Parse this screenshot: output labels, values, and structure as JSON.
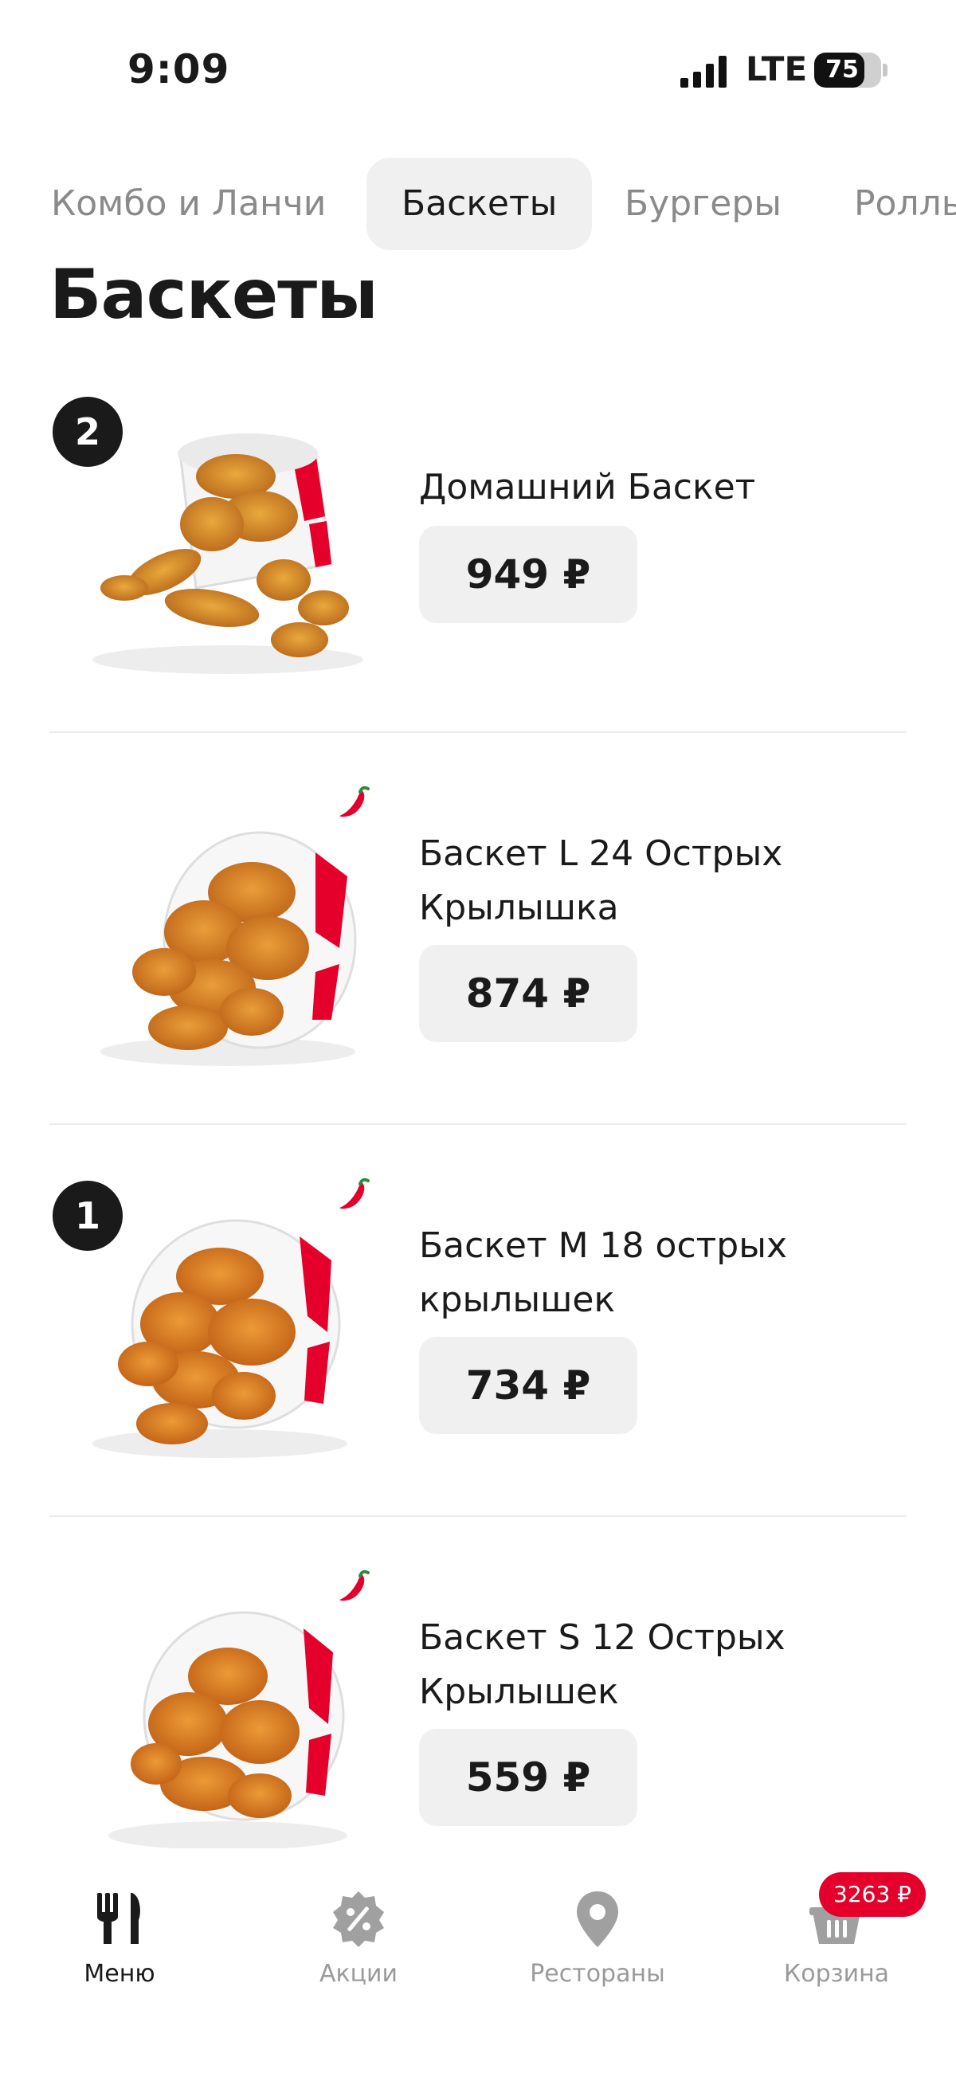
{
  "status_bar": {
    "time": "9:09",
    "network": "LTE",
    "battery": "75",
    "battery_level": 0.75
  },
  "tabs": [
    {
      "label": "Комбо и Ланчи",
      "active": false
    },
    {
      "label": "Баскеты",
      "active": true
    },
    {
      "label": "Бургеры",
      "active": false
    },
    {
      "label": "Роллы",
      "active": false
    }
  ],
  "page_title": "Баскеты",
  "products": [
    {
      "name": "Домашний Баскет",
      "price": "949 ₽",
      "qty_badge": "2",
      "spicy": false
    },
    {
      "name": "Баскет L 24 Острых Крылышка",
      "price": "874 ₽",
      "qty_badge": "",
      "spicy": true
    },
    {
      "name": "Баскет M 18 острых крылышек",
      "price": "734 ₽",
      "qty_badge": "1",
      "spicy": true
    },
    {
      "name": "Баскет S 12 Острых Крылышек",
      "price": "559 ₽",
      "qty_badge": "",
      "spicy": true
    }
  ],
  "bottom_nav": {
    "items": [
      {
        "label": "Меню",
        "icon": "fork-knife-icon",
        "active": true
      },
      {
        "label": "Акции",
        "icon": "discount-icon",
        "active": false
      },
      {
        "label": "Рестораны",
        "icon": "location-pin-icon",
        "active": false
      },
      {
        "label": "Корзина",
        "icon": "basket-icon",
        "active": false
      }
    ],
    "cart_total": "3263 ₽"
  },
  "colors": {
    "accent": "#e4002b",
    "text": "#1a1a1a",
    "muted": "#9a9a9a",
    "chip_bg": "#f0f0f0"
  }
}
